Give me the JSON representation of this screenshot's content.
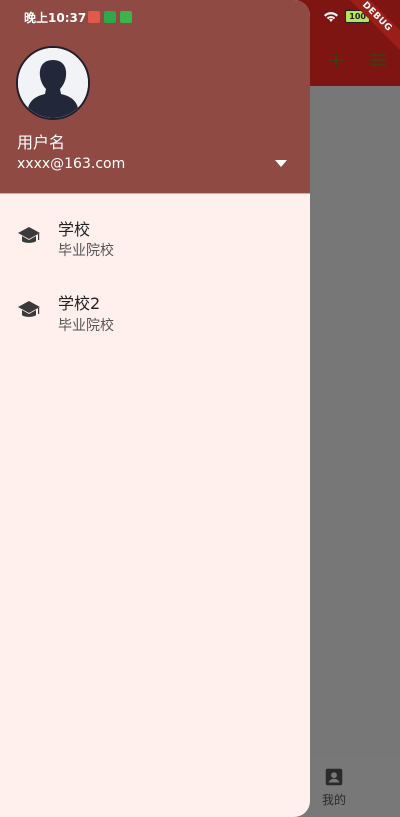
{
  "status_bar": {
    "time": "晚上10:37",
    "battery": "100"
  },
  "debug_banner": "DEBUG",
  "drawer": {
    "header": {
      "name": "用户名",
      "email": "xxxx@163.com"
    },
    "items": [
      {
        "title": "学校",
        "subtitle": "毕业院校"
      },
      {
        "title": "学校2",
        "subtitle": "毕业院校"
      }
    ]
  },
  "bottom_nav": {
    "me_label": "我的"
  },
  "colors": {
    "appbar": "#7e1512",
    "drawer_header": "#8f4a43",
    "drawer_bg": "#fff0ee"
  }
}
